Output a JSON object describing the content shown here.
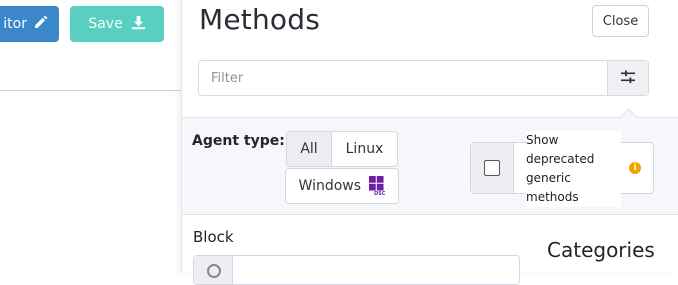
{
  "toolbar": {
    "editor_label": "itor",
    "save_label": "Save"
  },
  "panel": {
    "title": "Methods",
    "close_label": "Close",
    "filter": {
      "placeholder": "Filter",
      "value": ""
    },
    "agent_type": {
      "label": "Agent type:",
      "options": [
        "All",
        "Linux",
        "Windows"
      ],
      "selected": "All",
      "windows_badge": "DSC"
    },
    "deprecated": {
      "label": "Show deprecated generic methods",
      "checked": false,
      "info_icon": "i"
    },
    "block": {
      "label": "Block",
      "value": ""
    },
    "categories_title": "Categories"
  },
  "colors": {
    "editor_button": "#3a87c9",
    "save_button": "#59cfc1",
    "windows_logo": "#6a1fa5",
    "info": "#f2a000"
  },
  "icons": [
    "pencil-icon",
    "download-icon",
    "sliders-icon",
    "windows-dsc-icon",
    "info-icon"
  ]
}
